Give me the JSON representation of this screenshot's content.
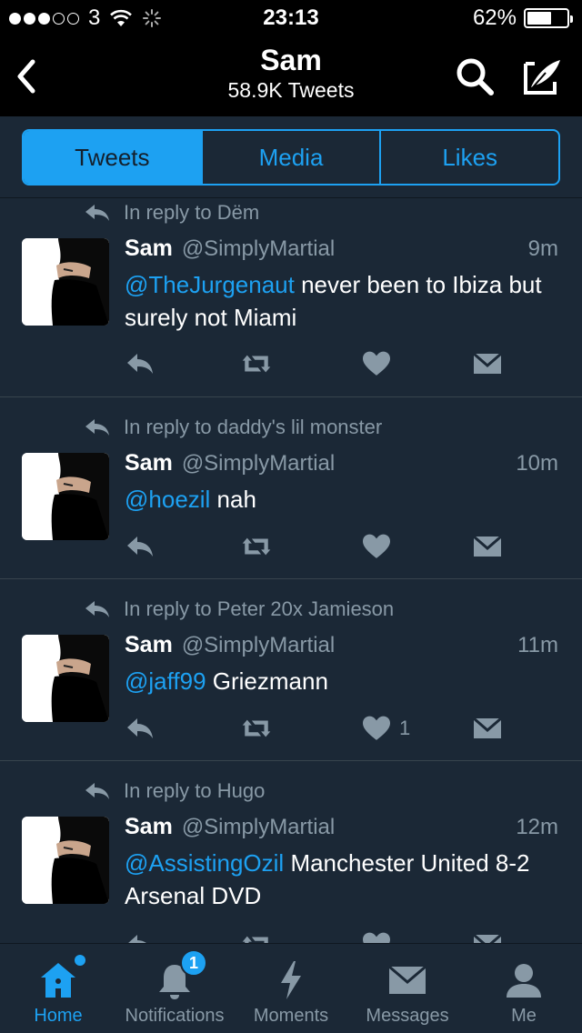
{
  "status_bar": {
    "carrier": "3",
    "time": "23:13",
    "battery_percent": "62%",
    "battery_level": 0.62
  },
  "header": {
    "title": "Sam",
    "subtitle": "58.9K Tweets"
  },
  "tabs": [
    {
      "label": "Tweets",
      "active": true
    },
    {
      "label": "Media",
      "active": false
    },
    {
      "label": "Likes",
      "active": false
    }
  ],
  "tweets": [
    {
      "reply_to": "In reply to Dëm",
      "name": "Sam",
      "handle": "@SimplyMartial",
      "time": "9m",
      "mention": "@TheJurgenaut",
      "text": " never been to Ibiza but surely not Miami",
      "like_count": ""
    },
    {
      "reply_to": "In reply to daddy's lil monster",
      "name": "Sam",
      "handle": "@SimplyMartial",
      "time": "10m",
      "mention": "@hoezil",
      "text": " nah",
      "like_count": ""
    },
    {
      "reply_to": "In reply to Peter 20x Jamieson",
      "name": "Sam",
      "handle": "@SimplyMartial",
      "time": "11m",
      "mention": "@jaff99",
      "text": " Griezmann",
      "like_count": "1"
    },
    {
      "reply_to": "In reply to Hugo",
      "name": "Sam",
      "handle": "@SimplyMartial",
      "time": "12m",
      "mention": "@AssistingOzil",
      "text": " Manchester United 8-2 Arsenal DVD",
      "like_count": ""
    }
  ],
  "tab_bar": {
    "home": "Home",
    "notifications": "Notifications",
    "notifications_badge": "1",
    "moments": "Moments",
    "messages": "Messages",
    "me": "Me"
  },
  "colors": {
    "accent": "#1da1f2",
    "background": "#1b2836",
    "muted": "#8899a6"
  }
}
